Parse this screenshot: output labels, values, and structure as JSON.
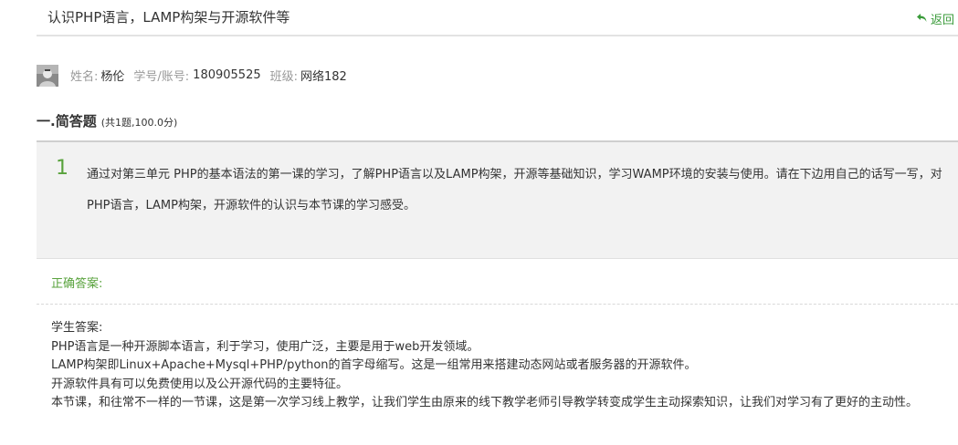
{
  "header": {
    "title": "认识PHP语言，LAMP构架与开源软件等",
    "back_label": "返回",
    "accent_color": "#3a9b3a"
  },
  "user": {
    "name_label": "姓名:",
    "name": "杨伦",
    "id_label": "学号/账号:",
    "id": "180905525",
    "class_label": "班级:",
    "class_name": "网络182"
  },
  "section": {
    "title": "一.简答题",
    "meta": "(共1题,100.0分)"
  },
  "question": {
    "number": "1",
    "text": "通过对第三单元 PHP的基本语法的第一课的学习，了解PHP语言以及LAMP构架，开源等基础知识，学习WAMP环境的安装与使用。请在下边用自己的话写一写，对PHP语言，LAMP构架，开源软件的认识与本节课的学习感受。"
  },
  "correct_answer_label": "正确答案:",
  "student_answer": {
    "label": "学生答案:",
    "lines": [
      "PHP语言是一种开源脚本语言，利于学习，使用广泛，主要是用于web开发领域。",
      "LAMP构架即Linux+Apache+Mysql+PHP/python的首字母缩写。这是一组常用来搭建动态网站或者服务器的开源软件。",
      "开源软件具有可以免费使用以及公开源代码的主要特征。",
      "本节课，和往常不一样的一节课，这是第一次学习线上教学，让我们学生由原来的线下教学老师引导教学转变成学生主动探索知识，让我们对学习有了更好的主动性。"
    ]
  }
}
